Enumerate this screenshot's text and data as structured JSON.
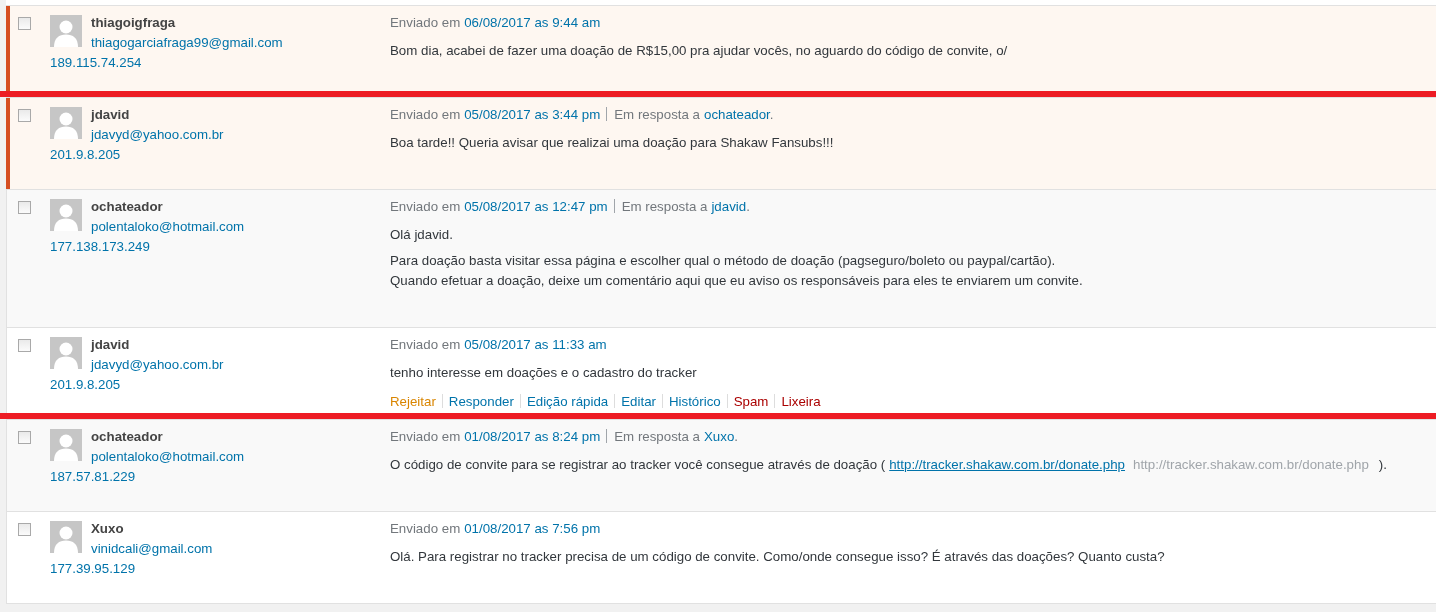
{
  "comments": [
    {
      "unapproved": true,
      "marked": true,
      "checked": false,
      "author": {
        "name": "thiagoigfraga",
        "email": "thiagogarciafraga99@gmail.com",
        "ip": "189.115.74.254"
      },
      "meta": {
        "sent_label": "Enviado em",
        "date": "06/08/2017 as 9:44 am"
      },
      "paragraphs": [
        [
          {
            "kind": "text",
            "text": "Bom dia, acabei de fazer uma doação de R$15,00 pra ajudar vocês, no aguardo do código de convite, o/"
          }
        ]
      ]
    },
    {
      "unapproved": true,
      "marked": false,
      "checked": false,
      "author": {
        "name": "jdavid",
        "email": "jdavyd@yahoo.com.br",
        "ip": "201.9.8.205"
      },
      "meta": {
        "sent_label": "Enviado em",
        "date": "05/08/2017 as 3:44 pm",
        "reply_label": "Em resposta a",
        "reply_to": "ochateador",
        "reply_end": "."
      },
      "paragraphs": [
        [
          {
            "kind": "text",
            "text": "Boa tarde!! Queria avisar que realizai uma doação para Shakaw Fansubs!!!"
          }
        ]
      ]
    },
    {
      "unapproved": false,
      "marked": false,
      "checked": false,
      "author": {
        "name": "ochateador",
        "email": "polentaloko@hotmail.com",
        "ip": "177.138.173.249"
      },
      "meta": {
        "sent_label": "Enviado em",
        "date": "05/08/2017 as 12:47 pm",
        "reply_label": "Em resposta a",
        "reply_to": "jdavid",
        "reply_end": "."
      },
      "paragraphs": [
        [
          {
            "kind": "text",
            "text": "Olá jdavid."
          }
        ],
        [
          {
            "kind": "text",
            "text": "Para doação basta visitar essa página e escolher qual o método de doação (pagseguro/boleto ou paypal/cartão).\nQuando efetuar a doação, deixe um comentário aqui que eu aviso os responsáveis para eles te enviarem um convite."
          }
        ]
      ]
    },
    {
      "unapproved": false,
      "marked": true,
      "checked": false,
      "author": {
        "name": "jdavid",
        "email": "jdavyd@yahoo.com.br",
        "ip": "201.9.8.205"
      },
      "meta": {
        "sent_label": "Enviado em",
        "date": "05/08/2017 as 11:33 am"
      },
      "paragraphs": [
        [
          {
            "kind": "text",
            "text": "tenho interesse em doações e o cadastro do tracker"
          }
        ]
      ],
      "actions": [
        {
          "kind": "warn",
          "label": "Rejeitar"
        },
        {
          "kind": "normal",
          "label": "Responder"
        },
        {
          "kind": "normal",
          "label": "Edição rápida"
        },
        {
          "kind": "normal",
          "label": "Editar"
        },
        {
          "kind": "normal",
          "label": "Histórico"
        },
        {
          "kind": "danger",
          "label": "Spam"
        },
        {
          "kind": "danger",
          "label": "Lixeira"
        }
      ]
    },
    {
      "unapproved": false,
      "marked": false,
      "checked": false,
      "author": {
        "name": "ochateador",
        "email": "polentaloko@hotmail.com",
        "ip": "187.57.81.229"
      },
      "meta": {
        "sent_label": "Enviado em",
        "date": "01/08/2017 as 8:24 pm",
        "reply_label": "Em resposta a",
        "reply_to": "Xuxo",
        "reply_end": "."
      },
      "paragraphs": [
        [
          {
            "kind": "text",
            "text": "O código de convite para se registrar ao tracker você consegue através de doação ("
          },
          {
            "kind": "link",
            "text": "http://tracker.shakaw.com.br/donate.php"
          },
          {
            "kind": "muted",
            "text": "http://tracker.shakaw.com.br/donate.php"
          },
          {
            "kind": "text",
            "text": ")."
          }
        ]
      ]
    },
    {
      "unapproved": false,
      "marked": false,
      "checked": false,
      "author": {
        "name": "Xuxo",
        "email": "vinidcali@gmail.com",
        "ip": "177.39.95.129"
      },
      "meta": {
        "sent_label": "Enviado em",
        "date": "01/08/2017 as 7:56 pm"
      },
      "paragraphs": [
        [
          {
            "kind": "text",
            "text": "Olá. Para registrar no tracker precisa de um código de convite. Como/onde consegue isso? É através das doações? Quanto custa?"
          }
        ]
      ]
    }
  ]
}
